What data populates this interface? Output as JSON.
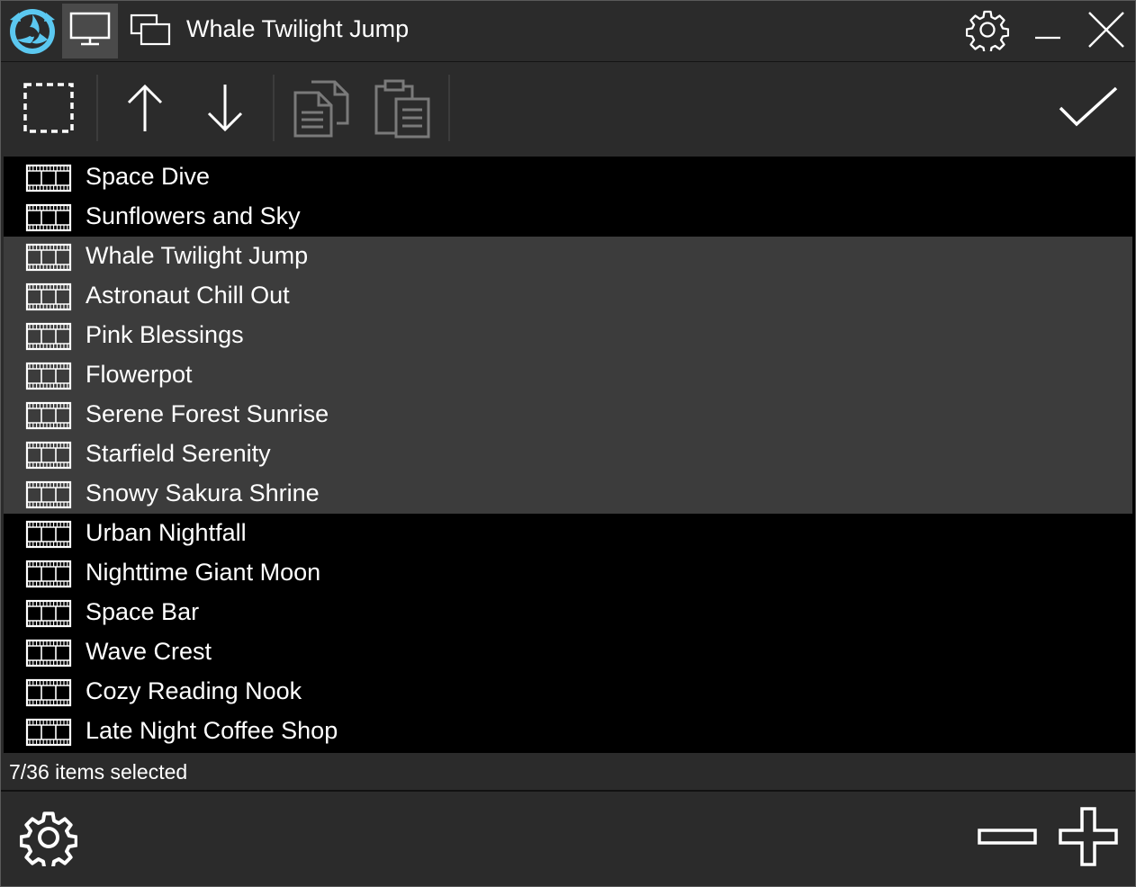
{
  "window": {
    "title": "Whale Twilight Jump"
  },
  "titlebar": {
    "icons": [
      "app-logo-icon",
      "monitor-icon",
      "windows-icon",
      "gear-icon",
      "minimize-icon",
      "close-icon"
    ]
  },
  "toolbar": {
    "icons": [
      "select-all-icon",
      "arrow-up-icon",
      "arrow-down-icon",
      "copy-icon",
      "paste-icon",
      "checkmark-icon"
    ]
  },
  "list": {
    "items": [
      {
        "label": "Space Dive",
        "selected": false
      },
      {
        "label": "Sunflowers and Sky",
        "selected": false
      },
      {
        "label": "Whale Twilight Jump",
        "selected": true
      },
      {
        "label": "Astronaut Chill Out",
        "selected": true
      },
      {
        "label": "Pink Blessings",
        "selected": true
      },
      {
        "label": "Flowerpot",
        "selected": true
      },
      {
        "label": "Serene Forest Sunrise",
        "selected": true
      },
      {
        "label": "Starfield Serenity",
        "selected": true
      },
      {
        "label": "Snowy Sakura Shrine",
        "selected": true
      },
      {
        "label": "Urban Nightfall",
        "selected": false
      },
      {
        "label": "Nighttime Giant Moon",
        "selected": false
      },
      {
        "label": "Space Bar",
        "selected": false
      },
      {
        "label": "Wave Crest",
        "selected": false
      },
      {
        "label": "Cozy Reading Nook",
        "selected": false
      },
      {
        "label": "Late Night Coffee Shop",
        "selected": false
      }
    ]
  },
  "status": {
    "text": "7/36 items selected"
  },
  "bottombar": {
    "icons": [
      "gear-icon",
      "minus-icon",
      "plus-icon"
    ]
  },
  "colors": {
    "chrome": "#2b2b2b",
    "list_bg": "#000000",
    "selected_row": "#3c3c3c",
    "active_tab": "#4a4a4a",
    "disabled_icon": "#7a7a7a",
    "logo_blue": "#5bc8f0"
  }
}
